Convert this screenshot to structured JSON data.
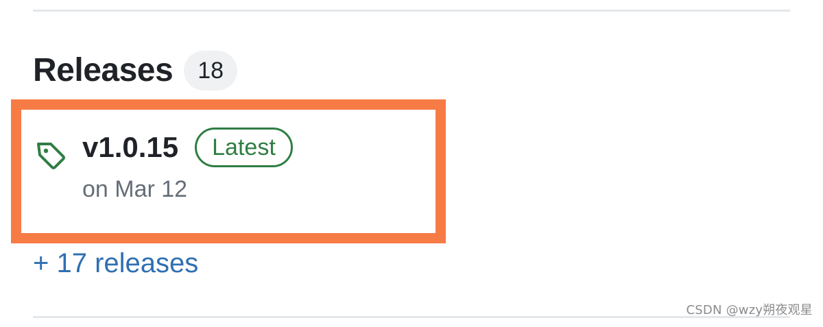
{
  "releases_section": {
    "title": "Releases",
    "count": "18",
    "latest_release": {
      "icon": "tag-icon",
      "version": "v1.0.15",
      "badge": "Latest",
      "date": "on Mar 12"
    },
    "more_link": "+ 17 releases"
  },
  "watermark": "CSDN @wzy朔夜观星",
  "colors": {
    "highlight": "#f67b45",
    "latest_badge": "#2f7d43",
    "link": "#2f6fb2",
    "title": "#1f2328",
    "secondary_text": "#656d76"
  }
}
